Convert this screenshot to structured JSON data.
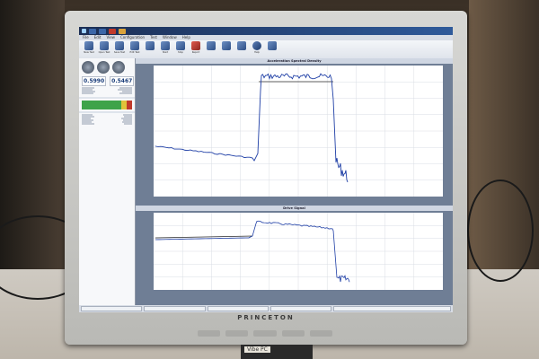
{
  "window": {
    "tabs": [
      "",
      "",
      "",
      ""
    ],
    "accent": "#2f5a9a"
  },
  "menu": [
    "File",
    "Edit",
    "View",
    "Configuration",
    "Test",
    "Window",
    "Help"
  ],
  "toolbar": {
    "tools": [
      {
        "label": "New Test",
        "icon": "new-test-icon"
      },
      {
        "label": "Open Test",
        "icon": "open-test-icon"
      },
      {
        "label": "Save Test",
        "icon": "save-test-icon"
      },
      {
        "label": "Edit Test",
        "icon": "edit-test-icon"
      },
      {
        "label": "",
        "icon": "settings-icon"
      },
      {
        "label": "Start",
        "icon": "start-icon"
      },
      {
        "label": "Stop",
        "icon": "stop-icon"
      },
      {
        "label": "Report",
        "icon": "report-icon"
      },
      {
        "label": "",
        "icon": "graph-icon"
      },
      {
        "label": "",
        "icon": "layout-icon"
      },
      {
        "label": "",
        "icon": "export-icon"
      },
      {
        "label": "Help",
        "icon": "help-icon"
      },
      {
        "label": "",
        "icon": "options-icon"
      }
    ]
  },
  "sidebar": {
    "readouts": [
      {
        "label": "",
        "value": "0.5990"
      },
      {
        "label": "",
        "value": "0.5467"
      }
    ],
    "meter_section": "",
    "params_section": ""
  },
  "plots": {
    "top_title": "Acceleration Spectral Density",
    "bottom_title": "Drive Signal",
    "line_color": "#1f3fa6",
    "ref_color": "#2b2b2b"
  },
  "status": {
    "panels": [
      "",
      "",
      "",
      "",
      ""
    ]
  }
}
